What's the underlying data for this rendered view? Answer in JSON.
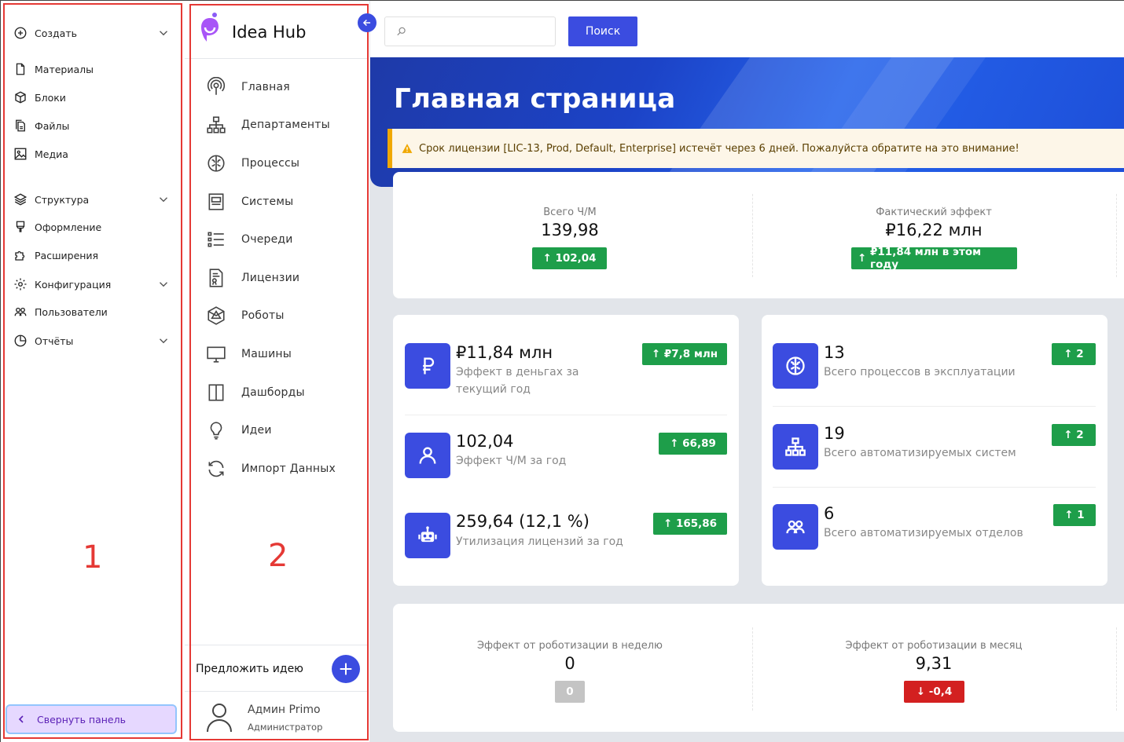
{
  "panel1": {
    "items": [
      {
        "label": "Создать",
        "icon": "plus-circle-icon",
        "has_chevron": true
      },
      {
        "label": "Материалы",
        "icon": "document-icon"
      },
      {
        "label": "Блоки",
        "icon": "cube-icon"
      },
      {
        "label": "Файлы",
        "icon": "files-icon"
      },
      {
        "label": "Медиа",
        "icon": "image-icon"
      },
      {
        "label": "Структура",
        "icon": "layers-icon",
        "has_chevron": true
      },
      {
        "label": "Оформление",
        "icon": "brush-icon"
      },
      {
        "label": "Расширения",
        "icon": "puzzle-icon"
      },
      {
        "label": "Конфигурация",
        "icon": "gear-icon",
        "has_chevron": true
      },
      {
        "label": "Пользователи",
        "icon": "users-icon"
      },
      {
        "label": "Отчёты",
        "icon": "pie-chart-icon",
        "has_chevron": true
      }
    ],
    "collapse_label": "Свернуть панель",
    "annotation": "1"
  },
  "panel2": {
    "app_name": "Idea Hub",
    "items": [
      {
        "label": "Главная",
        "icon": "podcast-icon"
      },
      {
        "label": "Департаменты",
        "icon": "sitemap-icon"
      },
      {
        "label": "Процессы",
        "icon": "brain-icon"
      },
      {
        "label": "Системы",
        "icon": "window-icon"
      },
      {
        "label": "Очереди",
        "icon": "list-icon"
      },
      {
        "label": "Лицензии",
        "icon": "license-icon"
      },
      {
        "label": "Роботы",
        "icon": "robot-icon"
      },
      {
        "label": "Машины",
        "icon": "monitor-icon"
      },
      {
        "label": "Дашборды",
        "icon": "columns-icon"
      },
      {
        "label": "Идеи",
        "icon": "lightbulb-icon"
      },
      {
        "label": "Импорт Данных",
        "icon": "refresh-icon"
      }
    ],
    "suggest_label": "Предложить идею",
    "user_name": "Админ Primo",
    "user_role": "Администратор",
    "annotation": "2"
  },
  "main": {
    "search_placeholder": "",
    "search_button": "Поиск",
    "page_title": "Главная страница",
    "license_alert": "Срок лицензии [LIC-13, Prod, Default, Enterprise] истечёт через 6 дней. Пожалуйста обратите на это внимание!",
    "summary": {
      "left": {
        "label": "Всего Ч/М",
        "value": "139,98",
        "badge": "102,04"
      },
      "right": {
        "label": "Фактический эффект",
        "value": "₽16,22 млн",
        "badge": "₽11,84 млн в этом году"
      }
    },
    "kpis_left": [
      {
        "value": "₽11,84 млн",
        "desc": "Эффект в деньгах за текущий год",
        "badge": "₽7,8 млн",
        "icon": "ruble-icon"
      },
      {
        "value": "102,04",
        "desc": "Эффект Ч/М за год",
        "badge": "66,89",
        "icon": "user-icon"
      },
      {
        "value": "259,64 (12,1 %)",
        "desc": "Утилизация лицензий за год",
        "badge": "165,86",
        "icon": "robot-icon"
      }
    ],
    "kpis_right": [
      {
        "value": "13",
        "desc": "Всего процессов в эксплуатации",
        "badge": "2",
        "icon": "brain-icon"
      },
      {
        "value": "19",
        "desc": "Всего автоматизируемых систем",
        "badge": "2",
        "icon": "sitemap-icon"
      },
      {
        "value": "6",
        "desc": "Всего автоматизируемых отделов",
        "badge": "1",
        "icon": "users-icon"
      }
    ],
    "robotization": {
      "left": {
        "label": "Эффект от роботизации в неделю",
        "value": "0",
        "badge": "0"
      },
      "right": {
        "label": "Эффект от роботизации в месяц",
        "value": "9,31",
        "badge": "-0,4"
      }
    },
    "colors": {
      "accent": "#3b4ce0",
      "success": "#1e9e4a",
      "danger": "#d32020",
      "annotation": "#e53935"
    }
  }
}
